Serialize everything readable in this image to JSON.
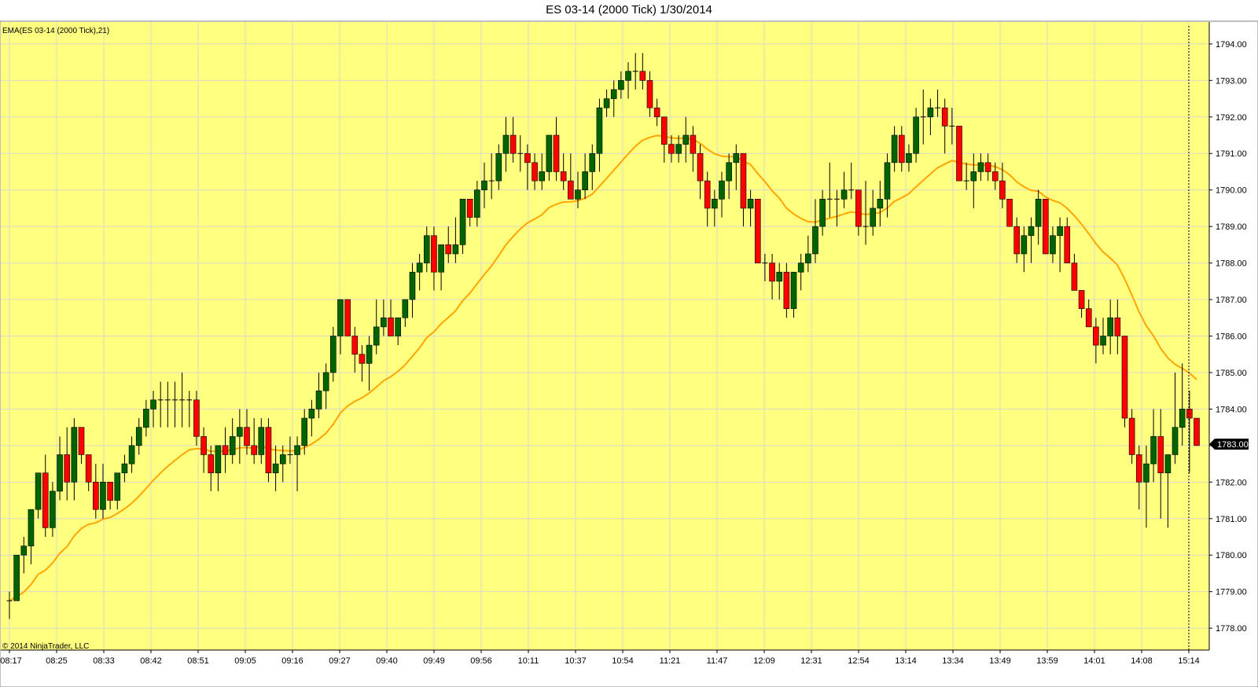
{
  "window": {
    "title": "ES 03-14 (2000 Tick)  1/30/2014"
  },
  "indicator_label": "EMA(ES 03-14 (2000 Tick),21)",
  "copyright": "© 2014 NinjaTrader, LLC",
  "last_price_label": "1783.00",
  "colors": {
    "background": "#ffff80",
    "up_candle": "#006400",
    "down_candle": "#ff0000",
    "wick": "#000000",
    "ema": "#ffa500",
    "grid": "#d8d8c8",
    "price_marker": "#000000"
  },
  "chart_data": {
    "type": "candlestick",
    "title": "ES 03-14 (2000 Tick)  1/30/2014",
    "ylim": [
      1777.4,
      1794.6
    ],
    "y_ticks": [
      "1778.00",
      "1779.00",
      "1780.00",
      "1781.00",
      "1782.00",
      "1783.00",
      "1784.00",
      "1785.00",
      "1786.00",
      "1787.00",
      "1788.00",
      "1789.00",
      "1790.00",
      "1791.00",
      "1792.00",
      "1793.00",
      "1794.00"
    ],
    "x_ticks": [
      "08:17",
      "08:25",
      "08:33",
      "08:42",
      "08:51",
      "09:05",
      "09:16",
      "09:27",
      "09:40",
      "09:49",
      "09:56",
      "10:11",
      "10:37",
      "10:54",
      "11:21",
      "11:47",
      "12:09",
      "12:31",
      "12:54",
      "13:14",
      "13:34",
      "13:49",
      "13:59",
      "14:01",
      "14:08",
      "15:14"
    ],
    "grid": true,
    "series": [
      {
        "name": "ES 03-14 (2000 Tick)",
        "candles": [
          [
            1778.75,
            1779.0,
            1778.25,
            1778.75
          ],
          [
            1778.75,
            1780.0,
            1778.75,
            1780.0
          ],
          [
            1780.0,
            1780.5,
            1779.5,
            1780.25
          ],
          [
            1780.25,
            1781.25,
            1779.75,
            1781.25
          ],
          [
            1781.25,
            1782.25,
            1781.0,
            1782.25
          ],
          [
            1782.25,
            1782.75,
            1780.5,
            1780.75
          ],
          [
            1780.75,
            1782.0,
            1780.5,
            1781.75
          ],
          [
            1781.75,
            1783.25,
            1781.5,
            1782.75
          ],
          [
            1782.75,
            1783.5,
            1781.5,
            1782.0
          ],
          [
            1782.0,
            1783.75,
            1781.5,
            1783.5
          ],
          [
            1783.5,
            1783.5,
            1782.5,
            1782.75
          ],
          [
            1782.75,
            1782.75,
            1781.75,
            1782.0
          ],
          [
            1782.0,
            1782.5,
            1781.0,
            1781.25
          ],
          [
            1781.25,
            1782.5,
            1781.0,
            1782.0
          ],
          [
            1782.0,
            1782.0,
            1781.25,
            1781.5
          ],
          [
            1781.5,
            1782.25,
            1781.25,
            1782.25
          ],
          [
            1782.25,
            1782.75,
            1782.0,
            1782.5
          ],
          [
            1782.5,
            1783.25,
            1782.25,
            1783.0
          ],
          [
            1783.0,
            1783.75,
            1782.75,
            1783.5
          ],
          [
            1783.5,
            1784.25,
            1783.25,
            1784.0
          ],
          [
            1784.0,
            1784.5,
            1783.5,
            1784.25
          ],
          [
            1784.25,
            1784.75,
            1783.5,
            1784.25
          ],
          [
            1784.25,
            1784.75,
            1783.5,
            1784.25
          ],
          [
            1784.25,
            1784.75,
            1783.5,
            1784.25
          ],
          [
            1784.25,
            1785.0,
            1783.5,
            1784.25
          ],
          [
            1784.25,
            1784.5,
            1783.5,
            1784.25
          ],
          [
            1784.25,
            1784.5,
            1783.0,
            1783.25
          ],
          [
            1783.25,
            1783.5,
            1782.25,
            1782.75
          ],
          [
            1782.75,
            1783.0,
            1781.75,
            1782.25
          ],
          [
            1782.25,
            1783.0,
            1781.75,
            1783.0
          ],
          [
            1783.0,
            1783.5,
            1782.25,
            1782.75
          ],
          [
            1782.75,
            1783.75,
            1782.5,
            1783.25
          ],
          [
            1783.25,
            1784.0,
            1782.5,
            1783.5
          ],
          [
            1783.5,
            1784.0,
            1782.75,
            1783.0
          ],
          [
            1783.0,
            1783.75,
            1782.5,
            1782.75
          ],
          [
            1782.75,
            1783.75,
            1782.5,
            1783.5
          ],
          [
            1783.5,
            1783.75,
            1782.0,
            1782.25
          ],
          [
            1782.25,
            1783.0,
            1781.75,
            1782.5
          ],
          [
            1782.5,
            1783.0,
            1782.0,
            1782.75
          ],
          [
            1782.75,
            1783.25,
            1782.5,
            1782.75
          ],
          [
            1782.75,
            1783.25,
            1781.75,
            1783.0
          ],
          [
            1783.0,
            1784.0,
            1782.75,
            1783.75
          ],
          [
            1783.75,
            1784.25,
            1783.25,
            1784.0
          ],
          [
            1784.0,
            1785.0,
            1783.75,
            1784.5
          ],
          [
            1784.5,
            1785.25,
            1784.0,
            1785.0
          ],
          [
            1785.0,
            1786.25,
            1784.75,
            1786.0
          ],
          [
            1786.0,
            1787.0,
            1785.5,
            1787.0
          ],
          [
            1787.0,
            1787.0,
            1786.0,
            1786.0
          ],
          [
            1786.0,
            1786.25,
            1785.0,
            1785.5
          ],
          [
            1785.5,
            1785.75,
            1784.75,
            1785.25
          ],
          [
            1785.25,
            1786.0,
            1784.5,
            1785.75
          ],
          [
            1785.75,
            1787.0,
            1785.5,
            1786.25
          ],
          [
            1786.25,
            1787.0,
            1786.0,
            1786.5
          ],
          [
            1786.5,
            1787.0,
            1786.0,
            1786.0
          ],
          [
            1786.0,
            1786.5,
            1785.75,
            1786.5
          ],
          [
            1786.5,
            1787.0,
            1786.25,
            1787.0
          ],
          [
            1787.0,
            1788.0,
            1786.5,
            1787.75
          ],
          [
            1787.75,
            1788.25,
            1787.25,
            1788.0
          ],
          [
            1788.0,
            1789.0,
            1787.75,
            1788.75
          ],
          [
            1788.75,
            1789.0,
            1787.25,
            1787.75
          ],
          [
            1787.75,
            1788.5,
            1787.25,
            1788.5
          ],
          [
            1788.5,
            1789.0,
            1788.0,
            1788.25
          ],
          [
            1788.25,
            1789.25,
            1788.0,
            1788.5
          ],
          [
            1788.5,
            1789.75,
            1788.25,
            1789.75
          ],
          [
            1789.75,
            1789.75,
            1789.0,
            1789.25
          ],
          [
            1789.25,
            1790.25,
            1789.0,
            1790.0
          ],
          [
            1790.0,
            1790.75,
            1789.5,
            1790.25
          ],
          [
            1790.25,
            1791.0,
            1789.75,
            1790.25
          ],
          [
            1790.25,
            1791.25,
            1790.0,
            1791.0
          ],
          [
            1791.0,
            1792.0,
            1790.5,
            1791.5
          ],
          [
            1791.5,
            1792.0,
            1790.75,
            1791.0
          ],
          [
            1791.0,
            1791.5,
            1790.5,
            1791.0
          ],
          [
            1791.0,
            1791.25,
            1790.0,
            1790.75
          ],
          [
            1790.75,
            1791.0,
            1790.0,
            1790.25
          ],
          [
            1790.25,
            1791.0,
            1790.0,
            1790.5
          ],
          [
            1790.5,
            1791.5,
            1790.25,
            1791.5
          ],
          [
            1791.5,
            1792.0,
            1790.25,
            1790.5
          ],
          [
            1790.5,
            1791.0,
            1790.0,
            1790.25
          ],
          [
            1790.25,
            1791.0,
            1789.75,
            1789.75
          ],
          [
            1789.75,
            1790.5,
            1789.5,
            1790.0
          ],
          [
            1790.0,
            1791.0,
            1789.75,
            1790.5
          ],
          [
            1790.5,
            1791.25,
            1790.0,
            1791.0
          ],
          [
            1791.0,
            1792.5,
            1790.5,
            1792.25
          ],
          [
            1792.25,
            1792.75,
            1792.0,
            1792.5
          ],
          [
            1792.5,
            1793.0,
            1792.0,
            1792.75
          ],
          [
            1792.75,
            1793.25,
            1792.5,
            1793.0
          ],
          [
            1793.0,
            1793.5,
            1792.5,
            1793.25
          ],
          [
            1793.25,
            1793.75,
            1792.75,
            1793.25
          ],
          [
            1793.25,
            1793.75,
            1792.75,
            1793.0
          ],
          [
            1793.0,
            1793.25,
            1792.0,
            1792.25
          ],
          [
            1792.25,
            1792.5,
            1791.75,
            1792.0
          ],
          [
            1792.0,
            1792.0,
            1790.75,
            1791.25
          ],
          [
            1791.25,
            1791.5,
            1790.75,
            1791.0
          ],
          [
            1791.0,
            1791.5,
            1790.75,
            1791.25
          ],
          [
            1791.25,
            1792.0,
            1790.75,
            1791.5
          ],
          [
            1791.5,
            1791.75,
            1790.5,
            1791.0
          ],
          [
            1791.0,
            1791.25,
            1789.75,
            1790.25
          ],
          [
            1790.25,
            1790.5,
            1789.0,
            1789.5
          ],
          [
            1789.5,
            1790.0,
            1789.0,
            1789.75
          ],
          [
            1789.75,
            1790.5,
            1789.25,
            1790.25
          ],
          [
            1790.25,
            1791.0,
            1789.75,
            1790.75
          ],
          [
            1790.75,
            1791.25,
            1790.0,
            1791.0
          ],
          [
            1791.0,
            1791.0,
            1789.0,
            1789.5
          ],
          [
            1789.5,
            1790.0,
            1789.0,
            1789.75
          ],
          [
            1789.75,
            1789.75,
            1788.0,
            1788.0
          ],
          [
            1788.0,
            1788.25,
            1787.5,
            1788.0
          ],
          [
            1788.0,
            1788.25,
            1787.0,
            1787.5
          ],
          [
            1787.5,
            1788.0,
            1787.0,
            1787.75
          ],
          [
            1787.75,
            1788.0,
            1786.5,
            1786.75
          ],
          [
            1786.75,
            1787.75,
            1786.5,
            1787.75
          ],
          [
            1787.75,
            1788.25,
            1787.25,
            1788.0
          ],
          [
            1788.0,
            1788.75,
            1787.75,
            1788.25
          ],
          [
            1788.25,
            1789.75,
            1788.0,
            1789.0
          ],
          [
            1789.0,
            1790.0,
            1788.75,
            1789.75
          ],
          [
            1789.75,
            1790.75,
            1789.25,
            1789.75
          ],
          [
            1789.75,
            1790.0,
            1789.0,
            1789.75
          ],
          [
            1789.75,
            1790.5,
            1789.5,
            1790.0
          ],
          [
            1790.0,
            1790.75,
            1789.75,
            1790.0
          ],
          [
            1790.0,
            1790.0,
            1788.75,
            1789.0
          ],
          [
            1789.0,
            1790.25,
            1788.5,
            1789.0
          ],
          [
            1789.0,
            1790.0,
            1788.75,
            1789.5
          ],
          [
            1789.5,
            1790.25,
            1789.0,
            1789.75
          ],
          [
            1789.75,
            1791.0,
            1789.25,
            1790.75
          ],
          [
            1790.75,
            1791.75,
            1790.5,
            1791.5
          ],
          [
            1791.5,
            1791.75,
            1790.5,
            1790.75
          ],
          [
            1790.75,
            1791.25,
            1790.5,
            1791.0
          ],
          [
            1791.0,
            1792.25,
            1790.75,
            1792.0
          ],
          [
            1792.0,
            1792.75,
            1791.25,
            1792.0
          ],
          [
            1792.0,
            1792.5,
            1791.5,
            1792.25
          ],
          [
            1792.25,
            1792.75,
            1792.0,
            1792.25
          ],
          [
            1792.25,
            1792.5,
            1791.0,
            1791.75
          ],
          [
            1791.75,
            1792.25,
            1791.25,
            1791.75
          ],
          [
            1791.75,
            1791.75,
            1790.25,
            1790.25
          ],
          [
            1790.25,
            1790.75,
            1790.0,
            1790.25
          ],
          [
            1790.25,
            1791.0,
            1789.5,
            1790.5
          ],
          [
            1790.5,
            1791.0,
            1790.25,
            1790.75
          ],
          [
            1790.75,
            1791.0,
            1790.25,
            1790.5
          ],
          [
            1790.5,
            1790.75,
            1790.0,
            1790.25
          ],
          [
            1790.25,
            1790.75,
            1789.5,
            1789.75
          ],
          [
            1789.75,
            1789.75,
            1789.0,
            1789.0
          ],
          [
            1789.0,
            1789.25,
            1788.0,
            1788.25
          ],
          [
            1788.25,
            1789.0,
            1787.75,
            1788.75
          ],
          [
            1788.75,
            1789.25,
            1788.0,
            1789.0
          ],
          [
            1789.0,
            1790.0,
            1788.5,
            1789.75
          ],
          [
            1789.75,
            1789.75,
            1788.25,
            1788.25
          ],
          [
            1788.25,
            1789.0,
            1788.0,
            1788.75
          ],
          [
            1788.75,
            1789.25,
            1787.75,
            1789.0
          ],
          [
            1789.0,
            1789.25,
            1788.0,
            1788.0
          ],
          [
            1788.0,
            1788.25,
            1787.25,
            1787.25
          ],
          [
            1787.25,
            1787.25,
            1786.5,
            1786.75
          ],
          [
            1786.75,
            1787.0,
            1786.25,
            1786.25
          ],
          [
            1786.25,
            1786.5,
            1785.25,
            1785.75
          ],
          [
            1785.75,
            1786.5,
            1785.5,
            1786.0
          ],
          [
            1786.0,
            1787.0,
            1785.5,
            1786.5
          ],
          [
            1786.5,
            1787.0,
            1785.5,
            1786.0
          ],
          [
            1786.0,
            1786.0,
            1783.5,
            1783.75
          ],
          [
            1783.75,
            1784.0,
            1782.5,
            1782.75
          ],
          [
            1782.75,
            1783.0,
            1781.25,
            1782.0
          ],
          [
            1782.0,
            1783.0,
            1780.75,
            1782.5
          ],
          [
            1782.5,
            1784.0,
            1782.0,
            1783.25
          ],
          [
            1783.25,
            1784.0,
            1781.0,
            1782.25
          ],
          [
            1782.25,
            1782.75,
            1780.75,
            1782.75
          ],
          [
            1782.75,
            1785.0,
            1782.5,
            1783.5
          ],
          [
            1783.5,
            1785.25,
            1783.0,
            1784.0
          ],
          [
            1784.0,
            1784.5,
            1782.25,
            1783.75
          ],
          [
            1783.75,
            1783.75,
            1783.0,
            1783.0
          ]
        ]
      },
      {
        "name": "EMA(ES 03-14 (2000 Tick),21)"
      }
    ]
  }
}
